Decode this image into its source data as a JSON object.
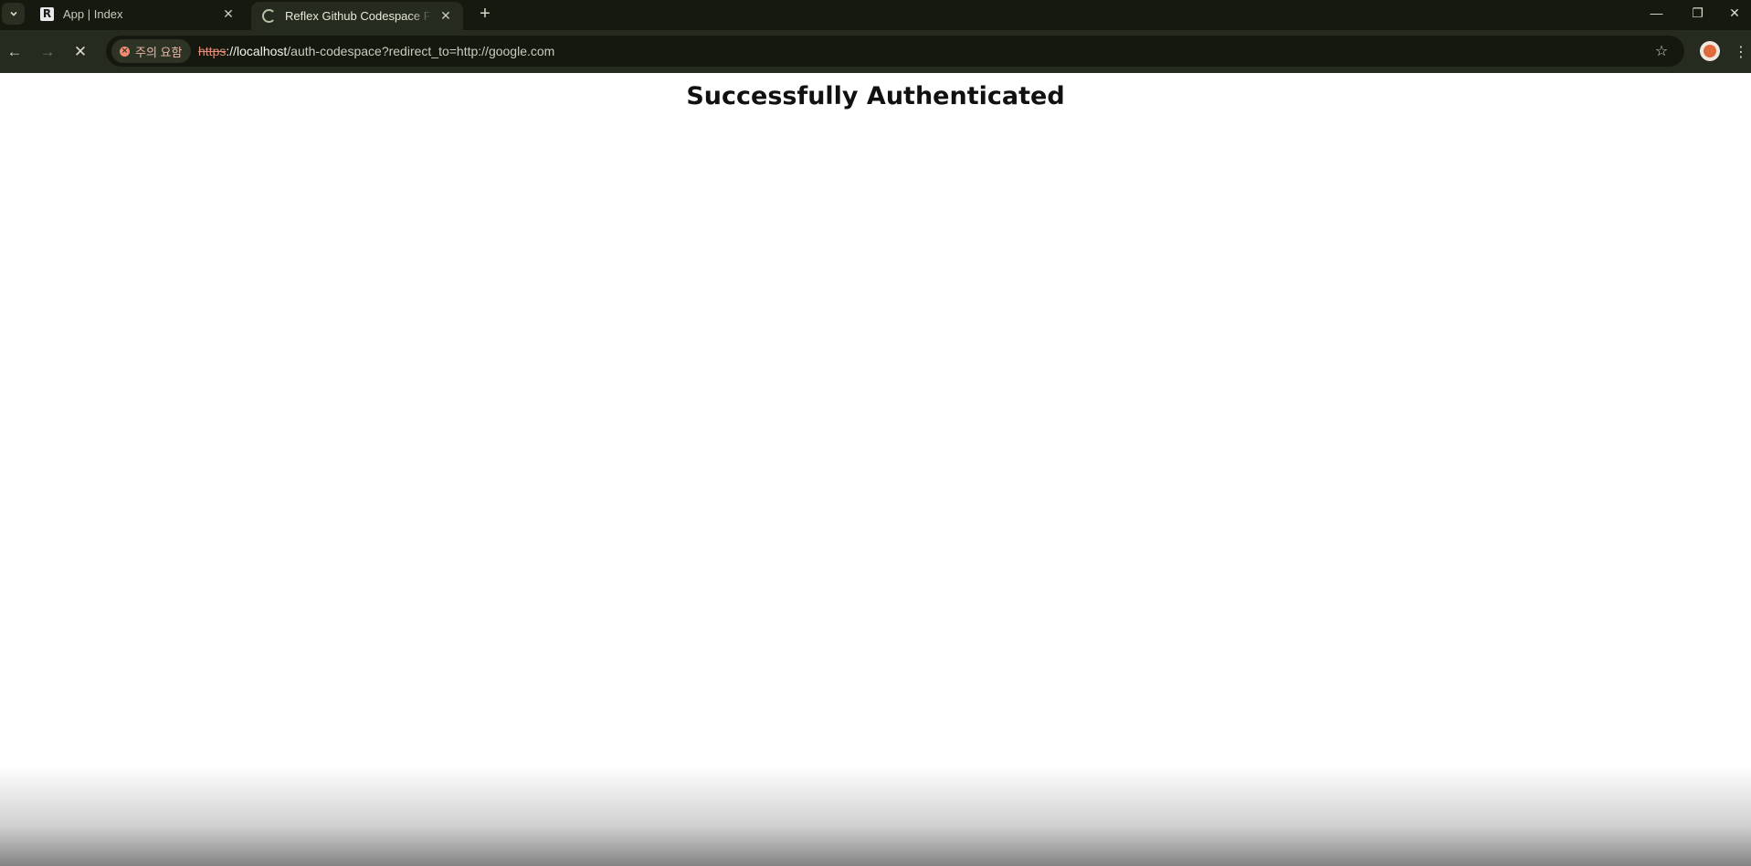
{
  "browser": {
    "tabs": [
      {
        "title": "App | Index",
        "favicon": "R",
        "state": "idle"
      },
      {
        "title": "Reflex Github Codespace Forw",
        "state": "loading"
      }
    ],
    "new_tab_label": "+",
    "window_controls": {
      "minimize": "—",
      "restore": "❐",
      "close": "✕"
    }
  },
  "toolbar": {
    "back": "←",
    "forward": "→",
    "stop": "✕",
    "security_chip_label": "주의 요함",
    "url": {
      "scheme": "https",
      "host": "://localhost",
      "path": "/auth-codespace?redirect_to=http://google.com"
    },
    "bookmark_star": "☆",
    "menu": "⋮"
  },
  "page": {
    "heading": "Successfully Authenticated"
  },
  "colors": {
    "tabstrip_bg": "#16190f",
    "toolbar_bg": "#252b1f",
    "omnibox_bg": "#14180e",
    "warning_accent": "#f28b72"
  }
}
